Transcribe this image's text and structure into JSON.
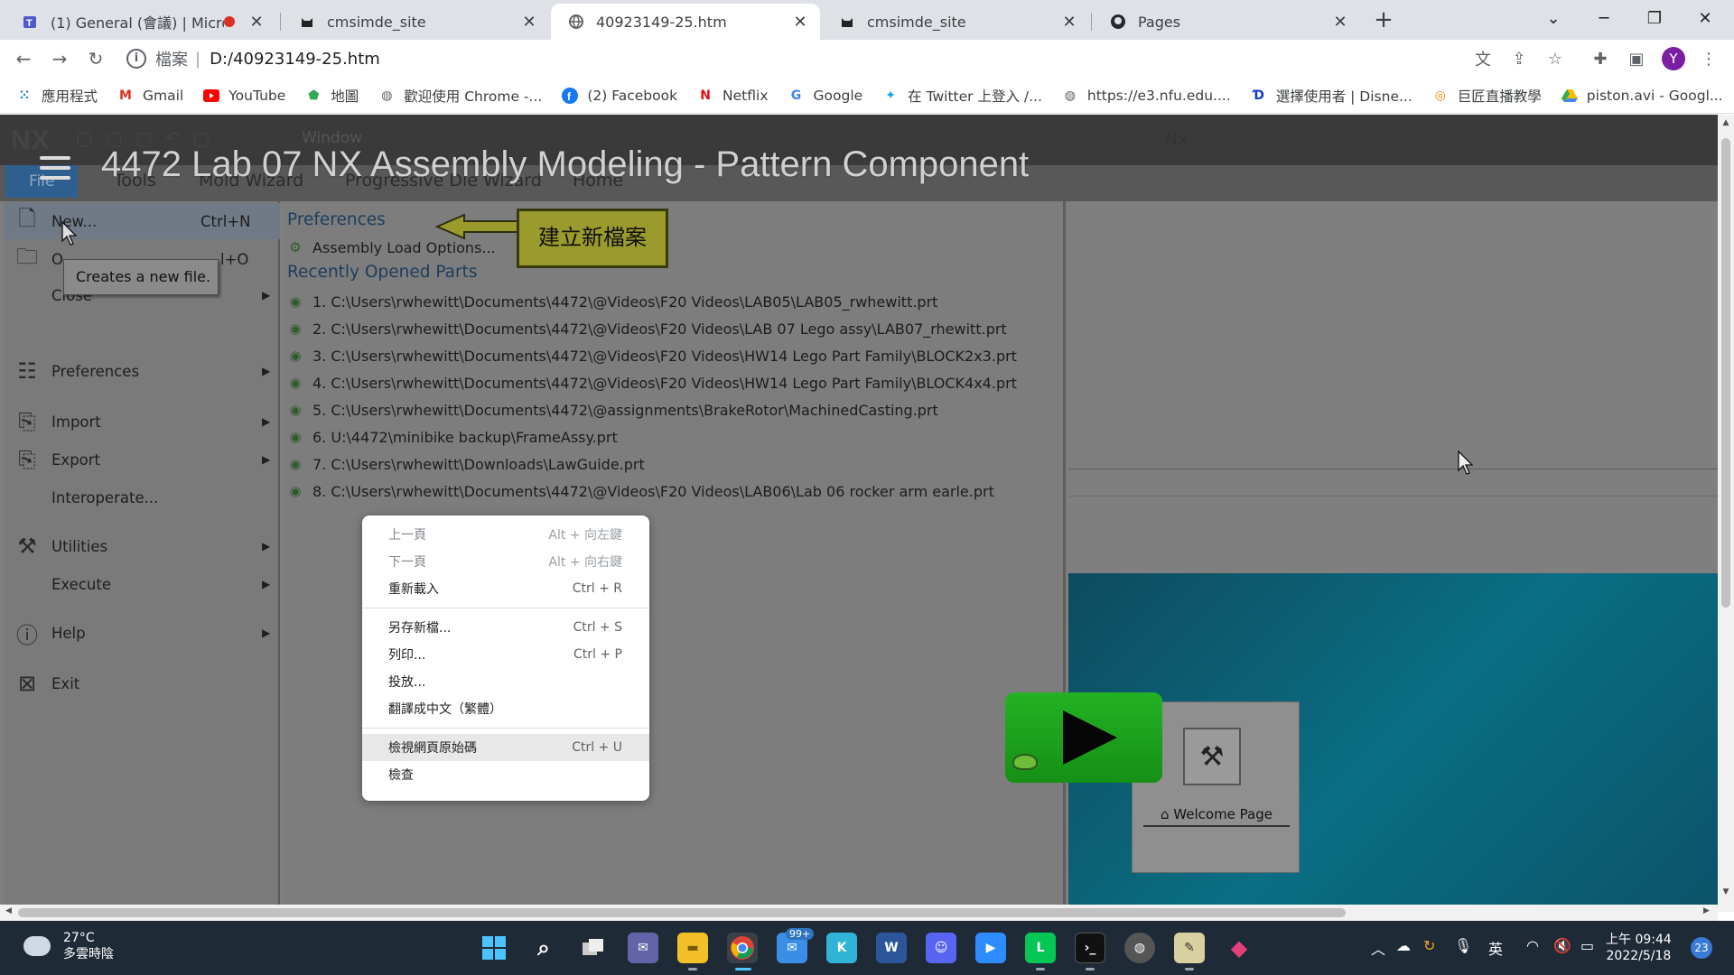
{
  "tabs": [
    {
      "title": "(1) General (會議) | Microso",
      "icon": "teams-icon",
      "recording": true
    },
    {
      "title": "cmsimde_site",
      "icon": "cat-icon"
    },
    {
      "title": "40923149-25.htm",
      "icon": "globe-icon",
      "active": true
    },
    {
      "title": "cmsimde_site",
      "icon": "cat-icon"
    },
    {
      "title": "Pages",
      "icon": "github-icon"
    }
  ],
  "address_bar": {
    "scheme_label": "檔案",
    "url": "D:/40923149-25.htm"
  },
  "bookmarks": [
    {
      "label": "應用程式",
      "icon": "apps-grid-icon"
    },
    {
      "label": "Gmail",
      "icon": "gmail-icon"
    },
    {
      "label": "YouTube",
      "icon": "youtube-icon"
    },
    {
      "label": "地圖",
      "icon": "maps-icon"
    },
    {
      "label": "歡迎使用 Chrome -...",
      "icon": "globe-icon"
    },
    {
      "label": "(2) Facebook",
      "icon": "facebook-icon"
    },
    {
      "label": "Netflix",
      "icon": "netflix-icon"
    },
    {
      "label": "Google",
      "icon": "google-icon"
    },
    {
      "label": "在 Twitter 上登入 /...",
      "icon": "twitter-icon"
    },
    {
      "label": "https://e3.nfu.edu....",
      "icon": "globe-icon"
    },
    {
      "label": "選擇使用者 | Disne...",
      "icon": "disney-icon"
    },
    {
      "label": "巨匠直播教學",
      "icon": "live-icon"
    },
    {
      "label": "piston.avi - Googl...",
      "icon": "drive-icon"
    }
  ],
  "video": {
    "title": "4472 Lab 07 NX Assembly Modeling - Pattern Component",
    "nx_logo": "NX",
    "window_menu": "Window",
    "center_title": "NX",
    "file_tab": "File",
    "ribbon_tabs": [
      "Tools",
      "Mold Wizard",
      "Progressive Die Wizard",
      "Home"
    ],
    "file_menu": [
      {
        "label": "New...",
        "shortcut": "Ctrl+N",
        "icon": "new-file-icon"
      },
      {
        "label": "O",
        "shortcut": "l+O",
        "icon": "open-folder-icon"
      },
      {
        "label": "Close",
        "icon": "close-file-icon",
        "submenu": true
      },
      {
        "label": "Preferences",
        "icon": "preferences-icon",
        "submenu": true
      },
      {
        "label": "Import",
        "icon": "import-icon",
        "submenu": true
      },
      {
        "label": "Export",
        "icon": "export-icon",
        "submenu": true
      },
      {
        "label": "Interoperate..."
      },
      {
        "label": "Utilities",
        "icon": "utilities-icon",
        "submenu": true
      },
      {
        "label": "Execute",
        "submenu": true
      },
      {
        "label": "Help",
        "icon": "help-icon",
        "submenu": true
      },
      {
        "label": "Exit",
        "icon": "exit-icon"
      }
    ],
    "tooltip": "Creates a new file.",
    "preferences_header": "Preferences",
    "assembly_load_options": "Assembly Load Options...",
    "recent_header": "Recently Opened Parts",
    "recent_parts": [
      "1. C:\\Users\\rwhewitt\\Documents\\4472\\@Videos\\F20 Videos\\LAB05\\LAB05_rwhewitt.prt",
      "2. C:\\Users\\rwhewitt\\Documents\\4472\\@Videos\\F20 Videos\\LAB 07  Lego assy\\LAB07_rhewitt.prt",
      "3. C:\\Users\\rwhewitt\\Documents\\4472\\@Videos\\F20 Videos\\HW14 Lego Part Family\\BLOCK2x3.prt",
      "4. C:\\Users\\rwhewitt\\Documents\\4472\\@Videos\\F20 Videos\\HW14 Lego Part Family\\BLOCK4x4.prt",
      "5. C:\\Users\\rwhewitt\\Documents\\4472\\@assignments\\BrakeRotor\\MachinedCasting.prt",
      "6. U:\\4472\\minibike backup\\FrameAssy.prt",
      "7. C:\\Users\\rwhewitt\\Downloads\\LawGuide.prt",
      "8. C:\\Users\\rwhewitt\\Documents\\4472\\@Videos\\F20 Videos\\LAB06\\Lab 06 rocker arm earle.prt"
    ],
    "callout": "建立新檔案",
    "welcome_label": "Welcome Page"
  },
  "context_menu": {
    "groups": [
      [
        {
          "label": "上一頁",
          "shortcut": "Alt + 向左鍵",
          "disabled": true
        },
        {
          "label": "下一頁",
          "shortcut": "Alt + 向右鍵",
          "disabled": true
        },
        {
          "label": "重新載入",
          "shortcut": "Ctrl + R"
        }
      ],
      [
        {
          "label": "另存新檔...",
          "shortcut": "Ctrl + S"
        },
        {
          "label": "列印...",
          "shortcut": "Ctrl + P"
        },
        {
          "label": "投放..."
        },
        {
          "label": "翻譯成中文（繁體）"
        }
      ],
      [
        {
          "label": "檢視網頁原始碼",
          "shortcut": "Ctrl + U",
          "highlighted": true
        },
        {
          "label": "檢查"
        }
      ]
    ]
  },
  "taskbar": {
    "weather_temp": "27°C",
    "weather_desc": "多雲時陰",
    "mail_badge": "99+",
    "ime": "英",
    "time": "上午 09:44",
    "date": "2022/5/18",
    "notifications": "23"
  },
  "colors": {
    "chrome_tab_bg": "#dee1e6",
    "video_bg": "#7f7f7f",
    "callout_bg": "#9b9a2c",
    "taskbar_bg": "#1f2a37",
    "play_green": "#1ea51e"
  }
}
